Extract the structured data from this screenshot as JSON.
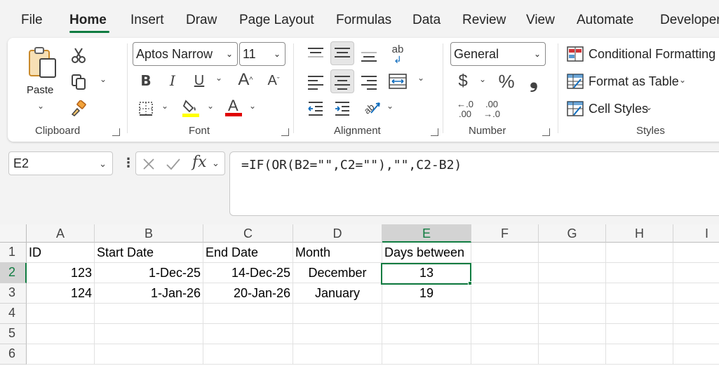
{
  "menu": {
    "tabs": [
      {
        "label": "File"
      },
      {
        "label": "Home"
      },
      {
        "label": "Insert"
      },
      {
        "label": "Draw"
      },
      {
        "label": "Page Layout"
      },
      {
        "label": "Formulas"
      },
      {
        "label": "Data"
      },
      {
        "label": "Review"
      },
      {
        "label": "View"
      },
      {
        "label": "Automate"
      },
      {
        "label": "Developer"
      }
    ],
    "active": "Home"
  },
  "ribbon": {
    "clipboard": {
      "group_label": "Clipboard",
      "paste_label": "Paste"
    },
    "font": {
      "group_label": "Font",
      "font_name": "Aptos Narrow",
      "font_size": "11",
      "bold": "B",
      "italic": "I",
      "underline": "U",
      "grow": "A",
      "shrink": "A",
      "font_color_glyph": "A"
    },
    "alignment": {
      "group_label": "Alignment",
      "wrap_glyph": "ab"
    },
    "number": {
      "group_label": "Number",
      "format": "General",
      "currency": "$",
      "percent": "%",
      "comma": "❟",
      "inc_decimal": "←.0 .00",
      "dec_decimal": ".00 →.0"
    },
    "styles": {
      "group_label": "Styles",
      "conditional_formatting": "Conditional Formatting",
      "format_as_table": "Format as Table",
      "cell_styles": "Cell Styles"
    },
    "colors": {
      "highlight": "#ffff00",
      "font_color": "#e00000",
      "accent": "#107c41"
    }
  },
  "formula_bar": {
    "name_box": "E2",
    "fx_label": "fx",
    "formula": "=IF(OR(B2=\"\",C2=\"\"),\"\",C2-B2)"
  },
  "sheet": {
    "columns": [
      "A",
      "B",
      "C",
      "D",
      "E",
      "F",
      "G",
      "H",
      "I"
    ],
    "rows": [
      "1",
      "2",
      "3",
      "4",
      "5",
      "6"
    ],
    "selected_cell": "E2",
    "cells": {
      "A1": "ID",
      "B1": "Start Date",
      "C1": "End Date",
      "D1": "Month",
      "E1": "Days between",
      "A2": "123",
      "B2": "1-Dec-25",
      "C2": "14-Dec-25",
      "D2": "December",
      "E2": "13",
      "A3": "124",
      "B3": "1-Jan-26",
      "C3": "20-Jan-26",
      "D3": "January",
      "E3": "19"
    }
  }
}
